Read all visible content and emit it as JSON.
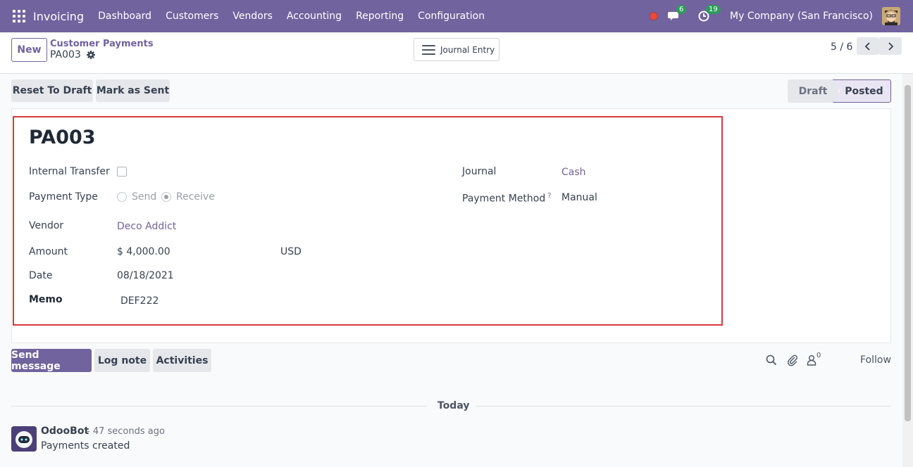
{
  "navbar": {
    "app_name": "Invoicing",
    "menu": [
      "Dashboard",
      "Customers",
      "Vendors",
      "Accounting",
      "Reporting",
      "Configuration"
    ],
    "messages_count": "6",
    "activities_count": "19",
    "company": "My Company (San Francisco)"
  },
  "control": {
    "new_label": "New",
    "breadcrumb": "Customer Payments",
    "record": "PA003",
    "journal_entry_label": "Journal Entry",
    "pager": "5 / 6"
  },
  "actions": {
    "reset_label": "Reset To Draft",
    "mark_sent_label": "Mark as Sent"
  },
  "statusbar": {
    "draft": "Draft",
    "posted": "Posted"
  },
  "form": {
    "title": "PA003",
    "internal_transfer_label": "Internal Transfer",
    "payment_type_label": "Payment Type",
    "send_label": "Send",
    "receive_label": "Receive",
    "vendor_label": "Vendor",
    "vendor_value": "Deco Addict",
    "amount_label": "Amount",
    "amount_value": "$ 4,000.00",
    "currency": "USD",
    "date_label": "Date",
    "date_value": "08/18/2021",
    "memo_label": "Memo",
    "memo_value": "DEF222",
    "journal_label": "Journal",
    "journal_value": "Cash",
    "payment_method_label": "Payment Method",
    "payment_method_help": "?",
    "payment_method_value": "Manual"
  },
  "chatter": {
    "send_message": "Send message",
    "log_note": "Log note",
    "activities": "Activities",
    "followers_count": "0",
    "follow": "Follow",
    "today": "Today",
    "author": "OdooBot",
    "time": "- 47 seconds ago",
    "message": "Payments created"
  },
  "colors": {
    "brand": "#71639e",
    "highlight_border": "#d7393d",
    "badge": "#2e9b5c"
  }
}
